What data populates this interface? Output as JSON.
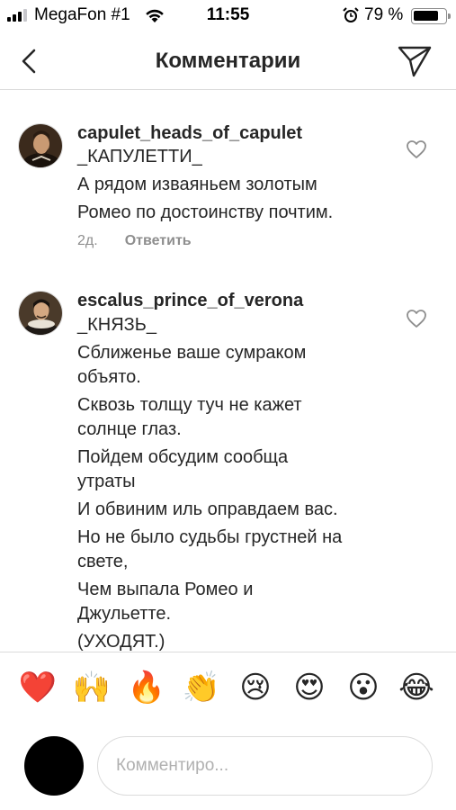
{
  "status_bar": {
    "carrier": "MegaFon #1",
    "time": "11:55",
    "battery_percent": "79 %",
    "battery_level": 0.79,
    "icons": [
      "signal-icon",
      "wifi-icon",
      "alarm-icon",
      "battery-icon"
    ]
  },
  "nav": {
    "title": "Комментарии",
    "back_icon": "chevron-left-icon",
    "send_icon": "direct-send-icon"
  },
  "comments": [
    {
      "username": "capulet_heads_of_capulet",
      "lines": [
        "_КАПУЛЕТТИ_",
        "А рядом изваяньем золотым",
        "Ромео по достоинству почтим."
      ],
      "time": "2д.",
      "reply_label": "Ответить"
    },
    {
      "username": "escalus_prince_of_verona",
      "lines": [
        "_КНЯЗЬ_",
        "Сближенье ваше сумраком объято.",
        "Сквозь толщу туч не кажет солнце глаз.",
        "Пойдем обсудим сообща утраты",
        "И обвиним иль оправдаем вас.",
        "Но не было судьбы грустней на свете,",
        "Чем выпала Ромео и Джульетте.",
        "(УХОДЯТ.)"
      ]
    }
  ],
  "emoji_bar": [
    "❤️",
    "🙌",
    "🔥",
    "👏",
    "😢",
    "😍",
    "😮",
    "😂"
  ],
  "composer": {
    "placeholder": "Комментиро..."
  }
}
